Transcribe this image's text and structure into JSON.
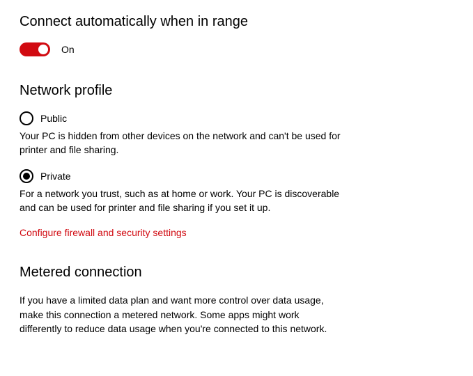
{
  "auto_connect": {
    "title": "Connect automatically when in range",
    "state_label": "On"
  },
  "network_profile": {
    "title": "Network profile",
    "public": {
      "label": "Public",
      "desc": "Your PC is hidden from other devices on the network and can't be used for printer and file sharing."
    },
    "private": {
      "label": "Private",
      "desc": "For a network you trust, such as at home or work. Your PC is discoverable and can be used for printer and file sharing if you set it up."
    },
    "firewall_link": "Configure firewall and security settings"
  },
  "metered": {
    "title": "Metered connection",
    "desc": "If you have a limited data plan and want more control over data usage, make this connection a metered network. Some apps might work differently to reduce data usage when you're connected to this network."
  }
}
